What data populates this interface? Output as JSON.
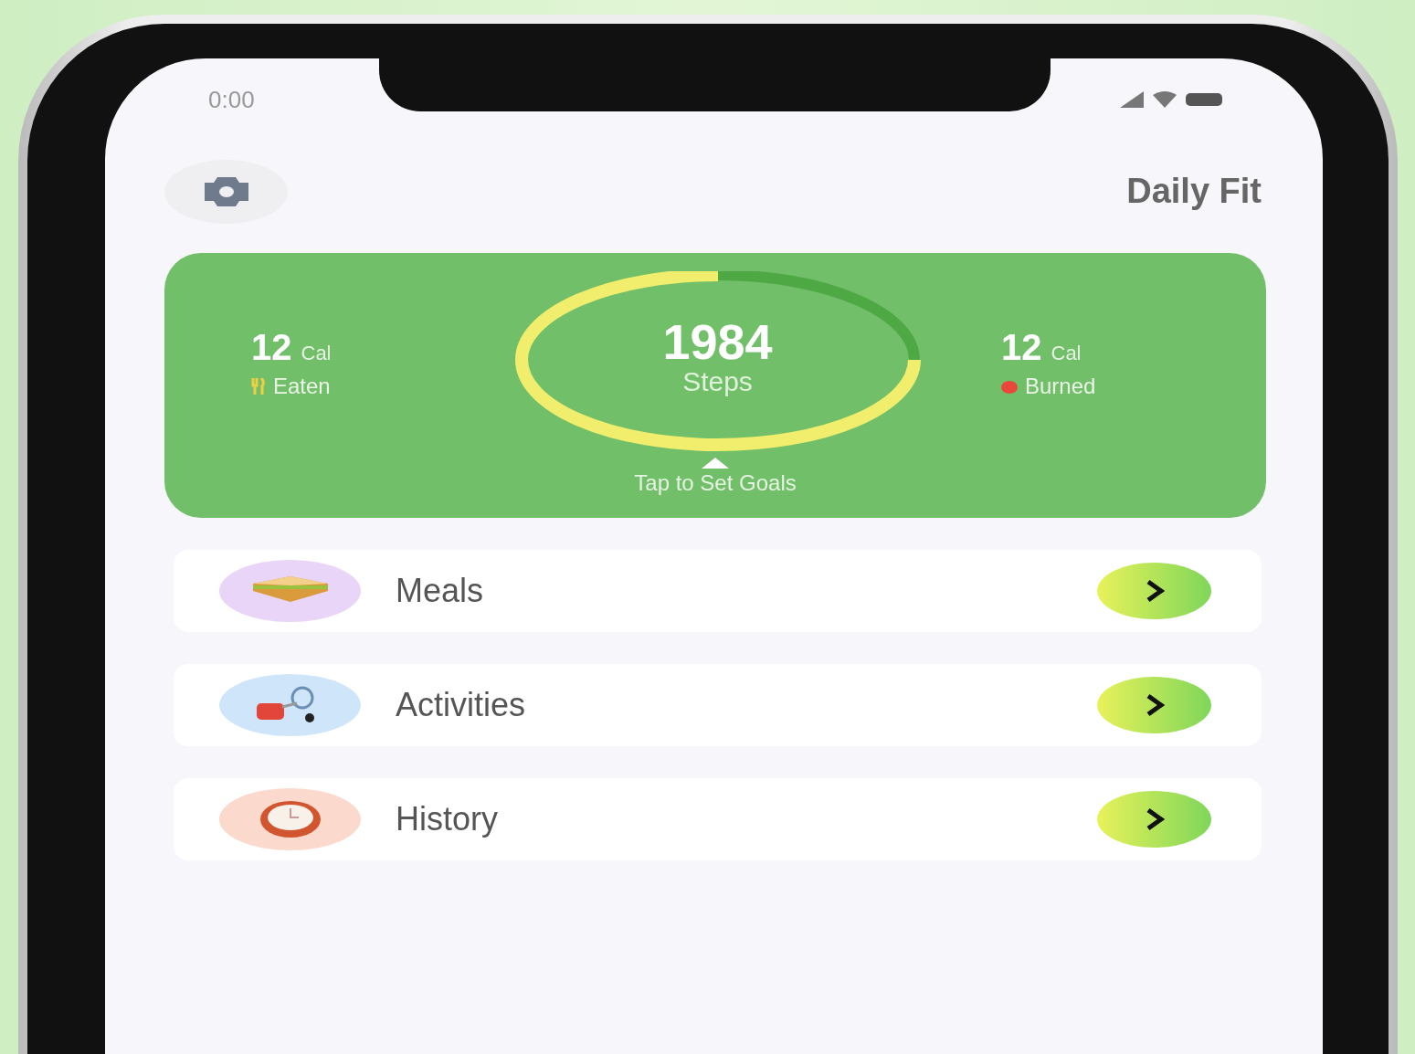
{
  "status_bar": {
    "time": "0:00"
  },
  "header": {
    "title": "Daily Fit"
  },
  "summary": {
    "eaten": {
      "value": "12",
      "unit": "Cal",
      "label": "Eaten"
    },
    "steps": {
      "value": "1984",
      "label": "Steps",
      "level": 0.75
    },
    "burned": {
      "value": "12",
      "unit": "Cal",
      "label": "Burned"
    },
    "hint": "Tap to Set Goals"
  },
  "menu": [
    {
      "label": "Meals",
      "kind": "meals",
      "color": "#e9d5f7"
    },
    {
      "label": "Activities",
      "kind": "activities",
      "color": "#cfe6fa"
    },
    {
      "label": "History",
      "kind": "history",
      "color": "#fbd9cc"
    }
  ]
}
